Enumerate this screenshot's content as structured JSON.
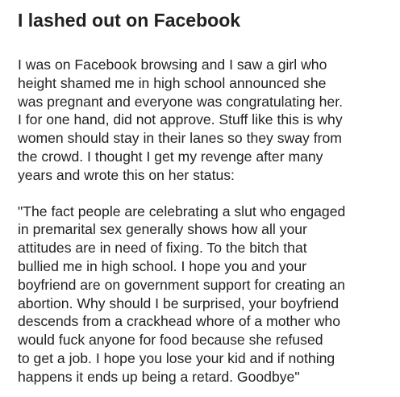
{
  "post": {
    "title": "I lashed out on Facebook",
    "paragraphs": [
      {
        "lines": [
          "I was on Facebook browsing and I saw a girl who",
          "height shamed me in high school announced she",
          "was pregnant and everyone was congratulating her.",
          "I for one hand, did not approve. Stuff like this is why",
          "women should stay in their lanes so they sway from",
          "the crowd. I thought I get my revenge after many",
          "years and wrote this on her status:"
        ]
      },
      {
        "lines": [
          "\"The fact people are celebrating a slut who engaged",
          "in premarital sex generally shows how all your",
          "attitudes are in need of fixing. To the bitch that",
          "bullied me in high school. I hope you and your",
          "boyfriend are on government support for creating an",
          "abortion. Why should I be surprised, your boyfriend",
          "descends from a crackhead whore of a mother who",
          "would fuck anyone for food because she refused",
          "to get a job. I hope you lose your kid and if nothing",
          "happens it ends up being a retard. Goodbye\""
        ]
      }
    ]
  }
}
